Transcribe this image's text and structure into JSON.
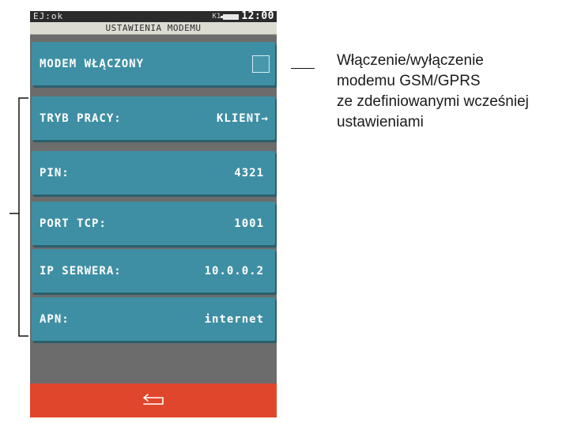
{
  "status_bar": {
    "left_text": "EJ:ok",
    "keyboard_indicator": "K1",
    "battery_icon": "battery-icon",
    "time": "12:00"
  },
  "title": "USTAWIENIA MODEMU",
  "menu": {
    "modem": {
      "label": "MODEM WŁĄCZONY",
      "checked": false
    },
    "mode": {
      "label": "TRYB PRACY:",
      "value": "KLIENT→"
    },
    "pin": {
      "label": "PIN:",
      "value": "4321"
    },
    "port": {
      "label": "PORT TCP:",
      "value": "1001"
    },
    "server_ip": {
      "label": "IP SERWERA:",
      "value": "10.0.0.2"
    },
    "apn": {
      "label": "APN:",
      "value": "internet"
    }
  },
  "footer": {
    "back_icon": "return-arrow-icon"
  },
  "annotation": {
    "lines": [
      "Włączenie/wyłączenie",
      "modemu GSM/GPRS",
      "ze zdefiniowanymi wcześniej",
      "ustawieniami"
    ]
  },
  "colors": {
    "item_background": "#3f8fa4",
    "screen_background": "#6c6c6c",
    "footer_background": "#e0462b",
    "title_bar_background": "#dcdcd3",
    "status_bar_background": "#2b2b2b"
  }
}
